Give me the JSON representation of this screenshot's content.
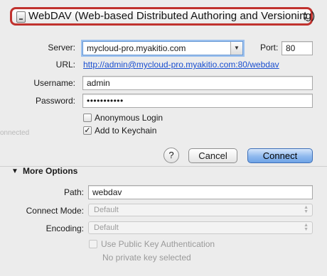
{
  "protocol": {
    "label": "WebDAV (Web-based Distributed Authoring and Versioning)"
  },
  "server": {
    "label": "Server:",
    "value": "mycloud-pro.myakitio.com"
  },
  "port": {
    "label": "Port:",
    "value": "80"
  },
  "url": {
    "label": "URL:",
    "value": "http://admin@mycloud-pro.myakitio.com:80/webdav"
  },
  "username": {
    "label": "Username:",
    "value": "admin"
  },
  "password": {
    "label": "Password:",
    "value": "•••••••••••"
  },
  "anonymous": {
    "label": "Anonymous Login",
    "checked": false
  },
  "keychain": {
    "label": "Add to Keychain",
    "checked": true
  },
  "buttons": {
    "help": "?",
    "cancel": "Cancel",
    "connect": "Connect"
  },
  "more_options": {
    "label": "More Options",
    "expanded": true
  },
  "path": {
    "label": "Path:",
    "value": "webdav"
  },
  "connect_mode": {
    "label": "Connect Mode:",
    "value": "Default"
  },
  "encoding": {
    "label": "Encoding:",
    "value": "Default"
  },
  "public_key": {
    "label": "Use Public Key Authentication",
    "status": "No private key selected"
  },
  "background_text": {
    "left_edge": "onnected"
  },
  "colors": {
    "accent": "#6fa3e6",
    "highlight_border": "#c0322e",
    "link": "#1a4fd0"
  }
}
